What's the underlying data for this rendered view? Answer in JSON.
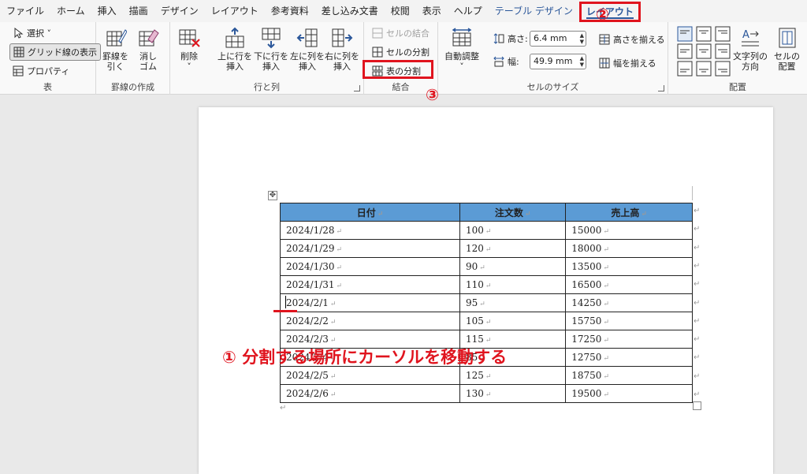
{
  "menu": {
    "tabs": [
      "ファイル",
      "ホーム",
      "挿入",
      "描画",
      "デザイン",
      "レイアウト",
      "参考資料",
      "差し込み文書",
      "校閲",
      "表示",
      "ヘルプ"
    ],
    "context_tab": "テーブル デザイン",
    "active_tab": "レイアウト"
  },
  "ribbon": {
    "group_table": {
      "label": "表",
      "select": "選択 ˅",
      "gridlines": "グリッド線の表示",
      "properties": "プロパティ"
    },
    "group_draw": {
      "label": "罫線の作成",
      "draw_line": [
        "罫線を",
        "引く"
      ],
      "eraser": [
        "消し",
        "ゴム"
      ]
    },
    "group_rows_cols": {
      "label": "行と列",
      "delete": [
        "削除",
        "˅"
      ],
      "insert_above": [
        "上に行を",
        "挿入"
      ],
      "insert_below": [
        "下に行を",
        "挿入"
      ],
      "insert_left": [
        "左に列を",
        "挿入"
      ],
      "insert_right": [
        "右に列を",
        "挿入"
      ]
    },
    "group_merge": {
      "label": "結合",
      "merge_cells": "セルの結合",
      "split_cells": "セルの分割",
      "split_table": "表の分割"
    },
    "group_cell_size": {
      "label": "セルのサイズ",
      "autofit": [
        "自動調整",
        "˅"
      ],
      "height_label": "高さ:",
      "height_value": "6.4 mm",
      "width_label": "幅:",
      "width_value": "49.9 mm",
      "distribute_rows": "高さを揃える",
      "distribute_cols": "幅を揃える"
    },
    "group_alignment": {
      "label": "配置",
      "text_direction": [
        "文字列の",
        "方向"
      ],
      "cell_margins": [
        "セルの",
        "配置"
      ]
    }
  },
  "annotations": {
    "step1": "① 分割する場所にカーソルを移動する",
    "step2": "②",
    "step3": "③"
  },
  "table": {
    "headers": [
      "日付",
      "注文数",
      "売上高"
    ],
    "rows": [
      [
        "2024/1/28",
        "100",
        "15000"
      ],
      [
        "2024/1/29",
        "120",
        "18000"
      ],
      [
        "2024/1/30",
        "90",
        "13500"
      ],
      [
        "2024/1/31",
        "110",
        "16500"
      ],
      [
        "2024/2/1",
        "95",
        "14250"
      ],
      [
        "2024/2/2",
        "105",
        "15750"
      ],
      [
        "2024/2/3",
        "115",
        "17250"
      ],
      [
        "2024/2/4",
        "85",
        "12750"
      ],
      [
        "2024/2/5",
        "125",
        "18750"
      ],
      [
        "2024/2/6",
        "130",
        "19500"
      ]
    ]
  },
  "colors": {
    "accent": "#2b579a",
    "highlight": "#e0141e",
    "header_fill": "#5b9bd5"
  }
}
